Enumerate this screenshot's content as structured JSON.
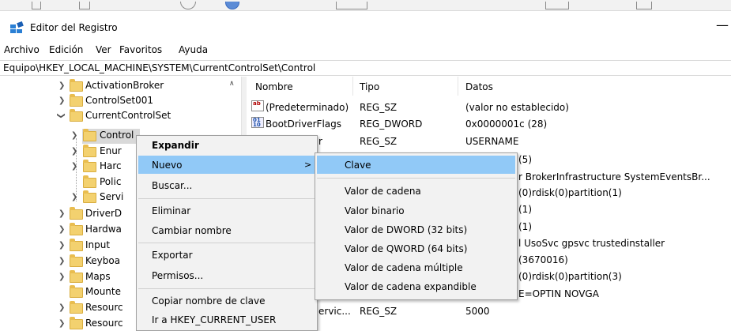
{
  "window": {
    "title": "Editor del Registro",
    "minimize_glyph": "—"
  },
  "menubar": {
    "items": [
      "Archivo",
      "Edición",
      "Ver",
      "Favoritos",
      "Ayuda"
    ]
  },
  "address": {
    "path": "Equipo\\HKEY_LOCAL_MACHINE\\SYSTEM\\CurrentControlSet\\Control"
  },
  "tree": {
    "items": [
      "ActivationBroker",
      "ControlSet001",
      "CurrentControlSet",
      "Control",
      "Enur",
      "Harc",
      "Polic",
      "Servi",
      "DriverD",
      "Hardwa",
      "Input",
      "Keyboa",
      "Maps",
      "Mounte",
      "Resourc",
      "Resourc"
    ]
  },
  "list": {
    "headers": {
      "name": "Nombre",
      "type": "Tipo",
      "data": "Datos"
    },
    "rows": [
      {
        "name": "(Predeterminado)",
        "type": "REG_SZ",
        "data": "(valor no establecido)"
      },
      {
        "name": "BootDriverFlags",
        "type": "REG_DWORD",
        "data": "0x0000001c (28)"
      },
      {
        "name": "r",
        "type": "REG_SZ",
        "data": "USERNAME"
      },
      {
        "name": "",
        "type": "",
        "data": "(5)"
      },
      {
        "name": "",
        "type": "",
        "data": "r BrokerInfrastructure SystemEventsBr..."
      },
      {
        "name": "",
        "type": "",
        "data": "(0)rdisk(0)partition(1)"
      },
      {
        "name": "",
        "type": "",
        "data": "(1)"
      },
      {
        "name": "",
        "type": "",
        "data": "(1)"
      },
      {
        "name": "",
        "type": "",
        "data": "l UsoSvc gpsvc trustedinstaller"
      },
      {
        "name": "",
        "type": "",
        "data": "(3670016)"
      },
      {
        "name": "",
        "type": "",
        "data": "(0)rdisk(0)partition(3)"
      },
      {
        "name": "",
        "type": "",
        "data": "E=OPTIN NOVGA"
      },
      {
        "name": "ervic...",
        "type": "REG_SZ",
        "data": "5000"
      }
    ]
  },
  "context_menu": {
    "expand": "Expandir",
    "new": "Nuevo",
    "search": "Buscar...",
    "delete": "Eliminar",
    "rename": "Cambiar nombre",
    "export": "Exportar",
    "permissions": "Permisos...",
    "copy_key_name": "Copiar nombre de clave",
    "goto_hkcu": "Ir a HKEY_CURRENT_USER",
    "submenu_arrow": ">"
  },
  "submenu": {
    "items": [
      "Clave",
      "Valor de cadena",
      "Valor binario",
      "Valor de DWORD (32 bits)",
      "Valor de QWORD (64 bits)",
      "Valor de cadena múltiple",
      "Valor de cadena expandible"
    ]
  },
  "colors": {
    "highlight": "#91c9f7",
    "selection": "#d9d9d9",
    "folder": "#f3d16f"
  }
}
